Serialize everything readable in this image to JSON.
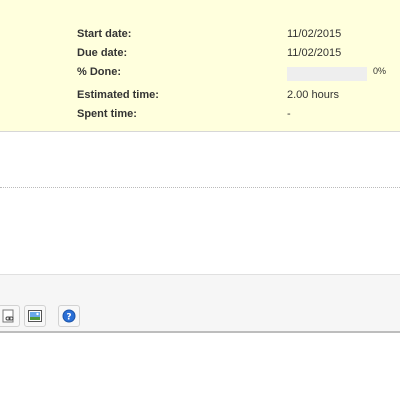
{
  "attributes": {
    "start_date": {
      "label": "Start date:",
      "value": "11/02/2015"
    },
    "due_date": {
      "label": "Due date:",
      "value": "11/02/2015"
    },
    "done": {
      "label": "% Done:",
      "percent": 0,
      "text": "0%"
    },
    "estimated_time": {
      "label": "Estimated time:",
      "value": "2.00 hours"
    },
    "spent_time": {
      "label": "Spent time:",
      "value": "-"
    }
  },
  "toolbar": {
    "buttons": [
      {
        "icon": "code-link-icon"
      },
      {
        "icon": "image-icon"
      },
      {
        "icon": "help-icon"
      }
    ]
  },
  "colors": {
    "attributes_bg": "#ffffdd",
    "progress_track": "#eeeeee",
    "progress_done": "#bae0ba",
    "help_blue": "#2a6fd6"
  }
}
